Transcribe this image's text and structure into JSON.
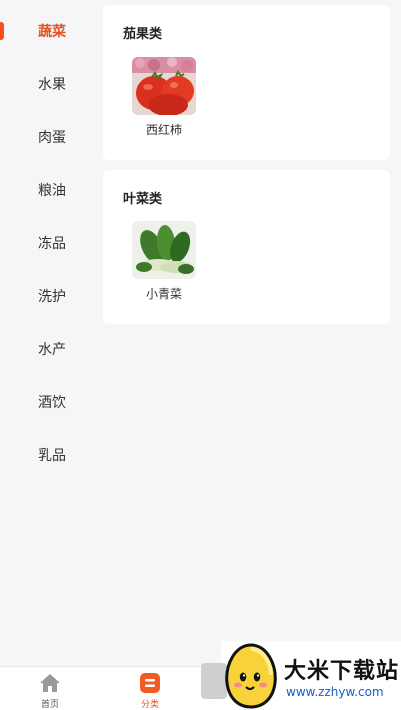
{
  "sidebar": {
    "items": [
      {
        "label": "蔬菜",
        "active": true
      },
      {
        "label": "水果",
        "active": false
      },
      {
        "label": "肉蛋",
        "active": false
      },
      {
        "label": "粮油",
        "active": false
      },
      {
        "label": "冻品",
        "active": false
      },
      {
        "label": "洗护",
        "active": false
      },
      {
        "label": "水产",
        "active": false
      },
      {
        "label": "酒饮",
        "active": false
      },
      {
        "label": "乳品",
        "active": false
      }
    ]
  },
  "sections": [
    {
      "title": "茄果类",
      "products": [
        {
          "name": "西红柿",
          "icon": "tomato-image"
        }
      ]
    },
    {
      "title": "叶菜类",
      "products": [
        {
          "name": "小青菜",
          "icon": "bok-choy-image"
        }
      ]
    }
  ],
  "tabbar": {
    "tabs": [
      {
        "label": "首页",
        "icon": "home-icon",
        "active": false
      },
      {
        "label": "分类",
        "icon": "category-icon",
        "active": true
      }
    ]
  },
  "watermark": {
    "brand": "大米下载站",
    "url": "www.zzhyw.com"
  },
  "colors": {
    "accent": "#e2541f",
    "background": "#f6f6f8",
    "card": "#ffffff",
    "watermark_url": "#1a5dc8"
  }
}
